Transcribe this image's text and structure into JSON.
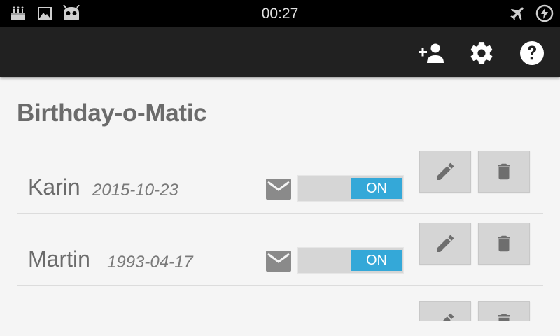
{
  "status_bar": {
    "time": "00:27",
    "left_icons": [
      "cake-icon",
      "image-icon",
      "android-robot-icon"
    ],
    "right_icons": [
      "airplane-mode-icon",
      "battery-charging-icon"
    ]
  },
  "action_bar": {
    "actions": [
      "add-person-icon",
      "settings-icon",
      "help-icon"
    ]
  },
  "page": {
    "title": "Birthday-o-Matic"
  },
  "birthdays": [
    {
      "name": "Karin",
      "date": "2015-10-23",
      "toggle_label": "ON"
    },
    {
      "name": "Martin",
      "date": "1993-04-17",
      "toggle_label": "ON"
    }
  ],
  "colors": {
    "toggle_on": "#34a8d8",
    "action_bar": "#212121",
    "status_bar": "#000000"
  }
}
